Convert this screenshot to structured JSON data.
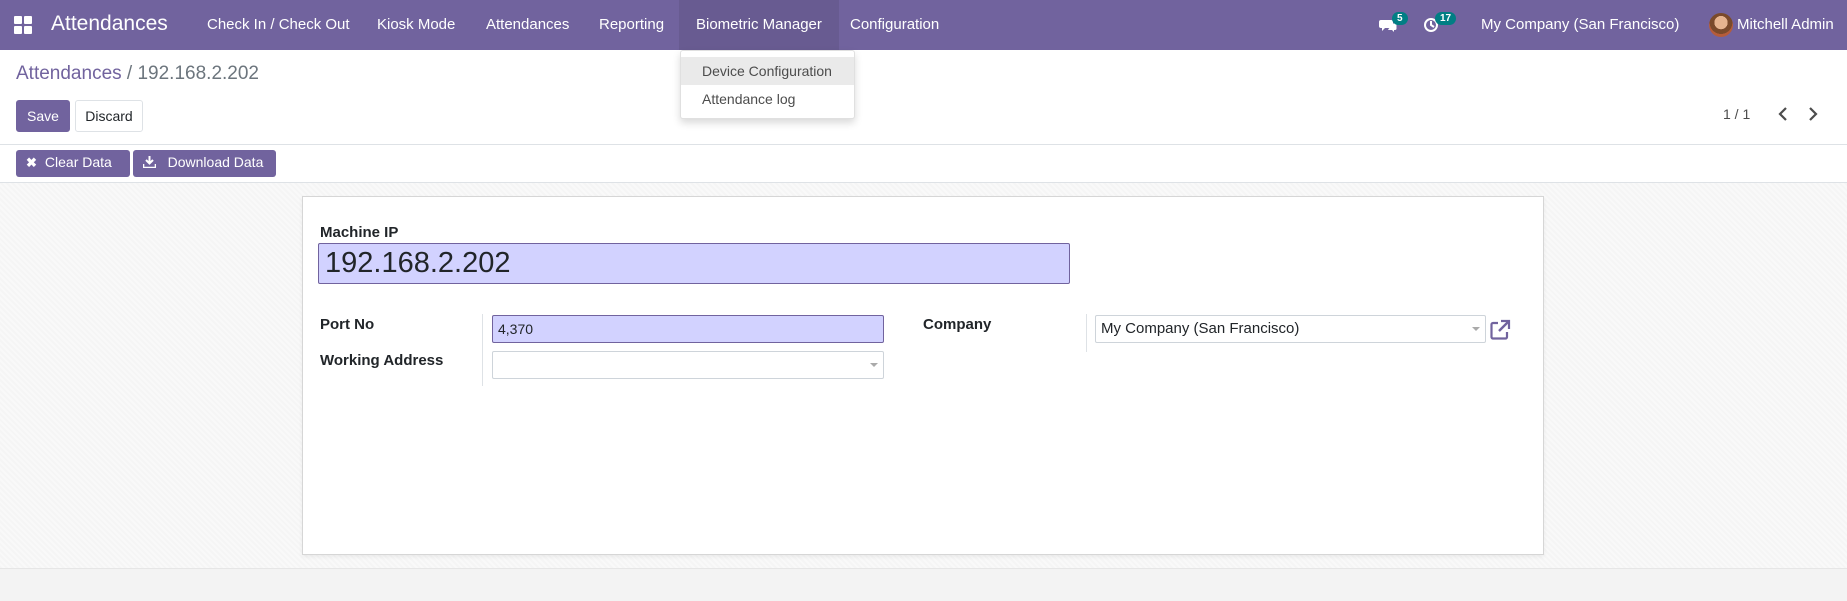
{
  "navbar": {
    "app_title": "Attendances",
    "menu": [
      {
        "label": "Check In / Check Out"
      },
      {
        "label": "Kiosk Mode"
      },
      {
        "label": "Attendances"
      },
      {
        "label": "Reporting"
      },
      {
        "label": "Biometric Manager"
      },
      {
        "label": "Configuration"
      }
    ],
    "messages_count": "5",
    "activities_count": "17",
    "company": "My Company (San Francisco)",
    "user_name": "Mitchell Admin",
    "bg_color": "#71639e"
  },
  "dropdown": {
    "items": [
      {
        "label": "Device Configuration"
      },
      {
        "label": "Attendance log"
      }
    ]
  },
  "breadcrumb": {
    "parent": "Attendances",
    "separator": "/",
    "current": "192.168.2.202"
  },
  "buttons": {
    "save": "Save",
    "discard": "Discard",
    "clear_data": "Clear Data",
    "download_data": "Download Data"
  },
  "pager": {
    "value": "1 / 1"
  },
  "form": {
    "machine_ip_label": "Machine IP",
    "machine_ip_value": "192.168.2.202",
    "port_no_label": "Port No",
    "port_no_value": "4,370",
    "working_address_label": "Working Address",
    "working_address_value": "",
    "company_label": "Company",
    "company_value": "My Company (San Francisco)"
  },
  "icons": {
    "apps": "apps-grid-icon",
    "messages": "chat-icon",
    "activities": "clock-icon",
    "clear": "x-icon",
    "download": "download-icon",
    "pager_prev": "chevron-left-icon",
    "pager_next": "chevron-right-icon",
    "external": "external-link-icon"
  }
}
